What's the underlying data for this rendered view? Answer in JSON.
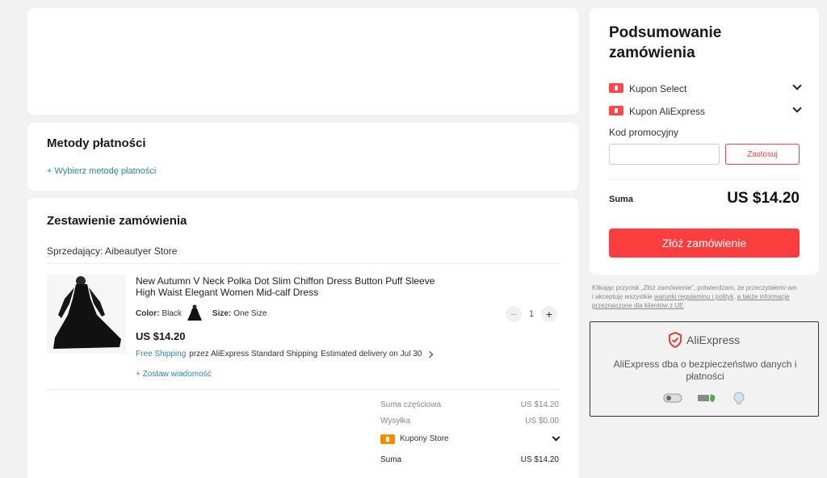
{
  "payment": {
    "title": "Metody płatności",
    "choose_link": "+ Wybierz metodę płatności"
  },
  "order": {
    "title": "Zestawienie zamówienia",
    "seller_label": "Sprzedający: Aibeautyer Store",
    "product": {
      "name_line1": "New Autumn V Neck Polka Dot Slim Chiffon Dress Button Puff Sleeve",
      "name_line2": "High Waist Elegant Women Mid-calf Dress",
      "color_label": "Color:",
      "color_value": "Black",
      "size_label": "Size:",
      "size_value": "One Size",
      "price": "US $14.20",
      "quantity": "1",
      "free_shipping": "Free Shipping",
      "shipping_detail": "przez AliExpress Standard Shipping",
      "delivery": "Estimated delivery on Jul 30",
      "leave_message": "+ Zostaw wiadomość"
    },
    "totals": {
      "subtotal_label": "Suma częściowa",
      "subtotal_value": "US $14.20",
      "shipping_label": "Wysyłka",
      "shipping_value": "US $0.00",
      "store_coupons_label": "Kupony Store",
      "sum_label": "Suma",
      "sum_value": "US $14.20"
    }
  },
  "summary": {
    "title_line1": "Podsumowanie",
    "title_line2": "zamówienia",
    "coupon_select": "Kupon Select",
    "coupon_aliexpress": "Kupon AliExpress",
    "promo_label": "Kod promocyjny",
    "promo_placeholder": "",
    "apply_button": "Zastosuj",
    "total_label": "Suma",
    "total_value": "US $14.20",
    "place_order": "Złóż zamówienie"
  },
  "legal": {
    "line1": "Klikając przycisk „Złóż zamówienie”, potwierdzam, że przeczytałem/-am",
    "line2_prefix": "i akceptuję wszystkie ",
    "line2_link": "warunki regulaminu i polityk",
    "line2_mid": ", ",
    "line2_link2": "a także informacje",
    "line3_link": "przeznaczone dla klientów z UE",
    "line3_suffix": "."
  },
  "security": {
    "brand": "AliExpress",
    "text_line1": "AliExpress dba o bezpieczeństwo danych i",
    "text_line2": "płatności"
  },
  "colors": {
    "accent_red": "#fd3e3e",
    "link_blue": "#2d86a5"
  }
}
